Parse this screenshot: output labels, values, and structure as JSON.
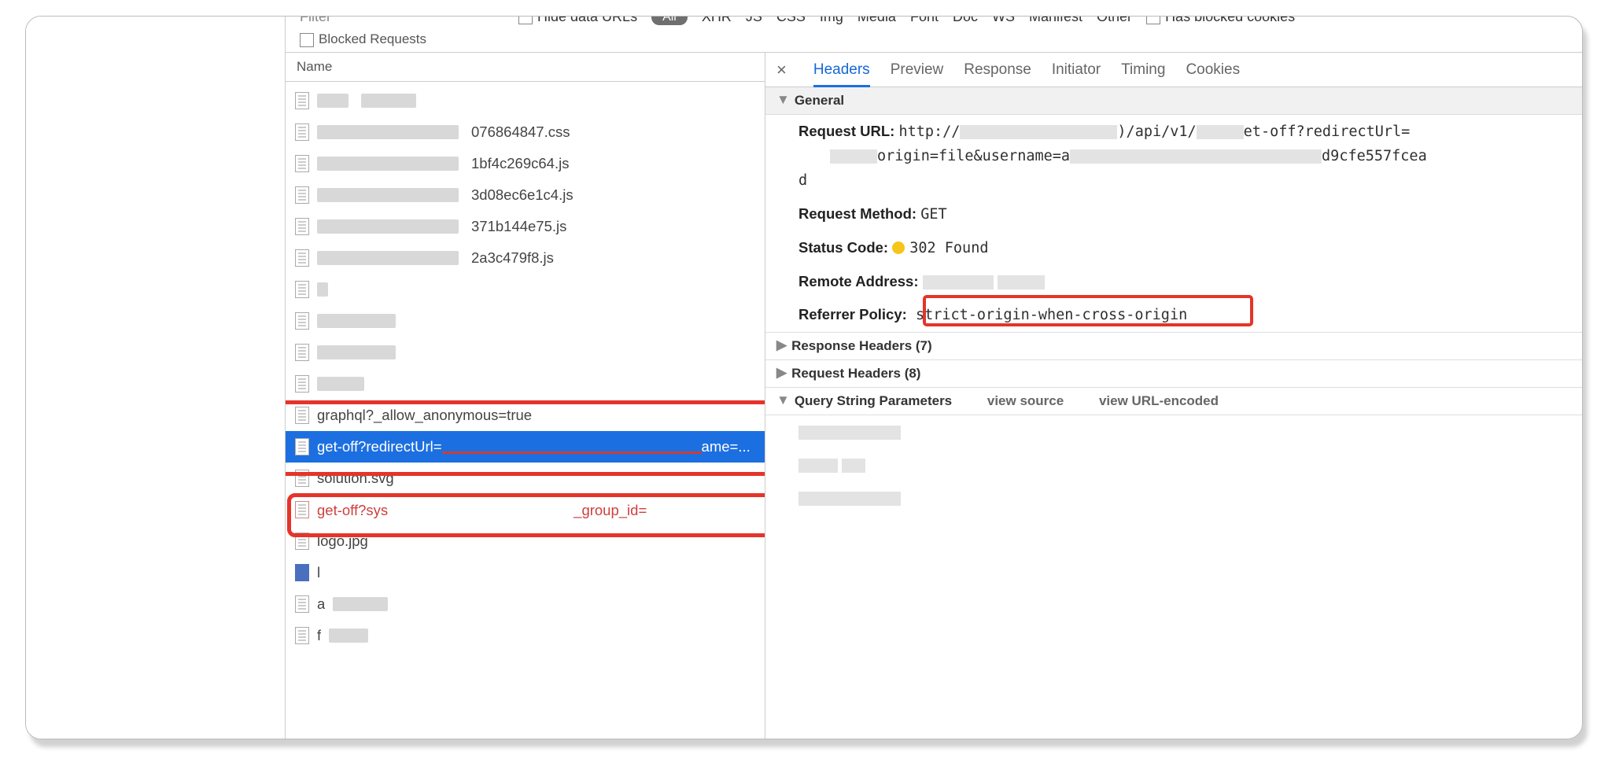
{
  "toolbar": {
    "filter_label": "Filter",
    "hide_data_urls": "Hide data URLs",
    "all": "All",
    "types": [
      "XHR",
      "JS",
      "CSS",
      "Img",
      "Media",
      "Font",
      "Doc",
      "WS",
      "Manifest",
      "Other"
    ],
    "has_blocked_cookies": "Has blocked cookies",
    "blocked_requests": "Blocked Requests"
  },
  "name_col": {
    "header": "Name",
    "rows": {
      "r2_suffix": "076864847.css",
      "r3_suffix": "1bf4c269c64.js",
      "r4_suffix": "3d08ec6e1c4.js",
      "r5_suffix": "371b144e75.js",
      "r6_suffix": "2a3c479f8.js",
      "r11": "graphql?_allow_anonymous=true",
      "r12": "get-off?redirectUrl=",
      "r12_tail": "ame=...",
      "r13": "solution.svg",
      "r14a": "get-off?sys",
      "r14b": "_group_id=",
      "r15": "logo.jpg",
      "r16": "l",
      "r17": "a",
      "r18": "f"
    }
  },
  "details": {
    "tabs": {
      "close": "×",
      "headers": "Headers",
      "preview": "Preview",
      "response": "Response",
      "initiator": "Initiator",
      "timing": "Timing",
      "cookies": "Cookies"
    },
    "general_label": "General",
    "request_url_label": "Request URL:",
    "request_url_a": "http://",
    "request_url_b": ")/api/v1/",
    "request_url_c": "et-off?redirectUrl=",
    "request_url_d": "origin=file&username=a",
    "request_url_e": "d9cfe557fcea",
    "request_url_f": "d",
    "request_method_label": "Request Method:",
    "request_method": "GET",
    "status_code_label": "Status Code:",
    "status_code": "302 Found",
    "remote_addr_label": "Remote Address:",
    "referrer_label": "Referrer Policy:",
    "referrer_value": "strict-origin-when-cross-origin",
    "resp_headers": "Response Headers (7)",
    "req_headers": "Request Headers (8)",
    "qsp": "Query String Parameters",
    "view_source": "view source",
    "view_url": "view URL-encoded"
  }
}
